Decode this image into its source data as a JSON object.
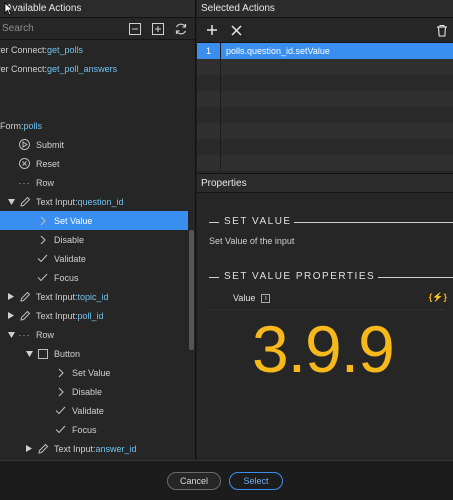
{
  "left_panel": {
    "title": "Available Actions",
    "search_placeholder": "Search",
    "icons": [
      "collapse-icon",
      "expand-icon",
      "refresh-icon"
    ],
    "tree": [
      {
        "indent": 0,
        "prefix": "Server Connect: ",
        "name": "get_polls",
        "icon": ""
      },
      {
        "indent": 0,
        "prefix": "Server Connect: ",
        "name": "get_poll_answers",
        "icon": ""
      },
      {
        "indent": 0,
        "prefix": "Row",
        "name": "",
        "icon": ""
      },
      {
        "indent": 0,
        "prefix": "Row",
        "name": "",
        "icon": ""
      },
      {
        "indent": 0,
        "prefix": "Form: ",
        "name": "polls",
        "icon": "form"
      },
      {
        "indent": 1,
        "prefix": "Submit",
        "name": "",
        "icon": "play"
      },
      {
        "indent": 1,
        "prefix": "Reset",
        "name": "",
        "icon": "x-circle"
      },
      {
        "indent": 1,
        "prefix": "Row",
        "name": "",
        "icon": "dots"
      },
      {
        "indent": 1,
        "prefix": "Text Input: ",
        "name": "question_id",
        "icon": "pencil",
        "toggle": "open"
      },
      {
        "indent": 2,
        "prefix": "Set Value",
        "name": "",
        "icon": "chevron",
        "selected": true
      },
      {
        "indent": 2,
        "prefix": "Disable",
        "name": "",
        "icon": "chevron"
      },
      {
        "indent": 2,
        "prefix": "Validate",
        "name": "",
        "icon": "check"
      },
      {
        "indent": 2,
        "prefix": "Focus",
        "name": "",
        "icon": "check"
      },
      {
        "indent": 1,
        "prefix": "Text Input: ",
        "name": "topic_id",
        "icon": "pencil",
        "toggle": "closed"
      },
      {
        "indent": 1,
        "prefix": "Text Input: ",
        "name": "poll_id",
        "icon": "pencil",
        "toggle": "closed"
      },
      {
        "indent": 1,
        "prefix": "Row",
        "name": "",
        "icon": "dots",
        "toggle": "open"
      },
      {
        "indent": 2,
        "prefix": "Button",
        "name": "",
        "icon": "square",
        "toggle": "open"
      },
      {
        "indent": 3,
        "prefix": "Set Value",
        "name": "",
        "icon": "chevron"
      },
      {
        "indent": 3,
        "prefix": "Disable",
        "name": "",
        "icon": "chevron"
      },
      {
        "indent": 3,
        "prefix": "Validate",
        "name": "",
        "icon": "check"
      },
      {
        "indent": 3,
        "prefix": "Focus",
        "name": "",
        "icon": "check"
      },
      {
        "indent": 2,
        "prefix": "Text Input: ",
        "name": "answer_id",
        "icon": "pencil",
        "toggle": "closed"
      }
    ]
  },
  "selected_actions": {
    "title": "Selected Actions",
    "rows": [
      {
        "num": "1",
        "value": "polls.question_id.setValue",
        "selected": true
      },
      {
        "num": "",
        "value": ""
      },
      {
        "num": "",
        "value": ""
      },
      {
        "num": "",
        "value": ""
      },
      {
        "num": "",
        "value": ""
      },
      {
        "num": "",
        "value": ""
      },
      {
        "num": "",
        "value": ""
      },
      {
        "num": "",
        "value": ""
      }
    ]
  },
  "properties": {
    "title": "Properties",
    "section1": "SET VALUE",
    "description": "Set Value of the input",
    "section2": "SET VALUE PROPERTIES",
    "value_label": "Value",
    "info": "i",
    "code_symbol": "{⚡}",
    "version": "3.9.9"
  },
  "footer": {
    "cancel": "Cancel",
    "select": "Select"
  }
}
